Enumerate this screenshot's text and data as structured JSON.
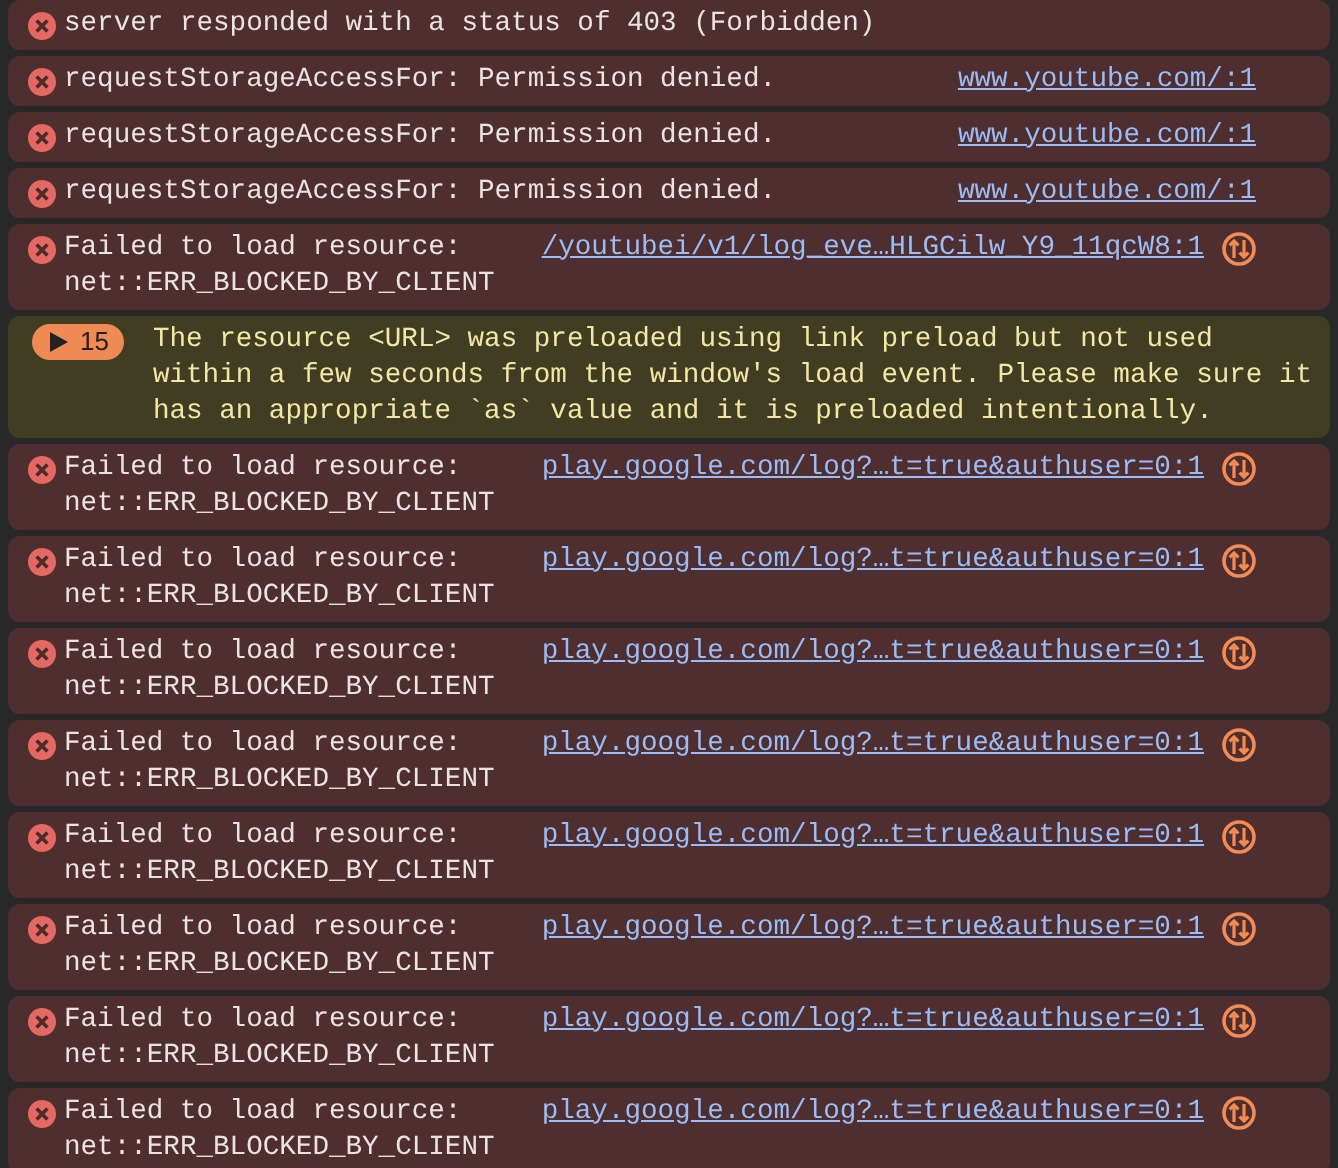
{
  "console_messages": [
    {
      "kind": "error",
      "message": "server responded with a status of 403 (Forbidden)",
      "network_icon": false
    },
    {
      "kind": "error",
      "message": "requestStorageAccessFor: Permission denied.",
      "link": "www.youtube.com/:1",
      "network_icon": false
    },
    {
      "kind": "error",
      "message": "requestStorageAccessFor: Permission denied.",
      "link": "www.youtube.com/:1",
      "network_icon": false
    },
    {
      "kind": "error",
      "message": "requestStorageAccessFor: Permission denied.",
      "link": "www.youtube.com/:1",
      "network_icon": false
    },
    {
      "kind": "error",
      "message": "Failed to load resource: net::ERR_BLOCKED_BY_CLIENT",
      "link": "/youtubei/v1/log_eve…HLGCilw_Y9_11qcW8:1",
      "network_icon": true
    },
    {
      "kind": "warning",
      "count": "15",
      "message": "The resource <URL> was preloaded using link preload but not used within a few seconds from the window's load event. Please make sure it has an appropriate `as` value and it is preloaded intentionally."
    },
    {
      "kind": "error",
      "message": "Failed to load resource: net::ERR_BLOCKED_BY_CLIENT",
      "link": "play.google.com/log?…t=true&authuser=0:1",
      "network_icon": true
    },
    {
      "kind": "error",
      "message": "Failed to load resource: net::ERR_BLOCKED_BY_CLIENT",
      "link": "play.google.com/log?…t=true&authuser=0:1",
      "network_icon": true
    },
    {
      "kind": "error",
      "message": "Failed to load resource: net::ERR_BLOCKED_BY_CLIENT",
      "link": "play.google.com/log?…t=true&authuser=0:1",
      "network_icon": true
    },
    {
      "kind": "error",
      "message": "Failed to load resource: net::ERR_BLOCKED_BY_CLIENT",
      "link": "play.google.com/log?…t=true&authuser=0:1",
      "network_icon": true
    },
    {
      "kind": "error",
      "message": "Failed to load resource: net::ERR_BLOCKED_BY_CLIENT",
      "link": "play.google.com/log?…t=true&authuser=0:1",
      "network_icon": true
    },
    {
      "kind": "error",
      "message": "Failed to load resource: net::ERR_BLOCKED_BY_CLIENT",
      "link": "play.google.com/log?…t=true&authuser=0:1",
      "network_icon": true
    },
    {
      "kind": "error",
      "message": "Failed to load resource: net::ERR_BLOCKED_BY_CLIENT",
      "link": "play.google.com/log?…t=true&authuser=0:1",
      "network_icon": true
    },
    {
      "kind": "error",
      "message": "Failed to load resource: net::ERR_BLOCKED_BY_CLIENT",
      "link": "play.google.com/log?…t=true&authuser=0:1",
      "network_icon": true
    }
  ]
}
